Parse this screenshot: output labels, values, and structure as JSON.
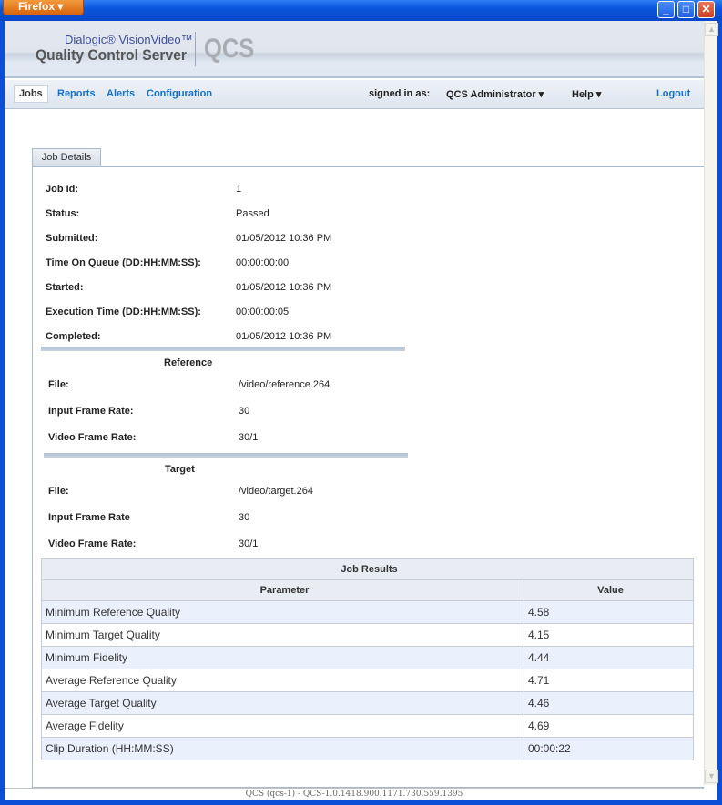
{
  "browser": {
    "menu_label": "Firefox"
  },
  "logo": {
    "line1": "Dialogic® VisionVideo™",
    "line2": "Quality Control Server",
    "mark": "QCS"
  },
  "nav": {
    "items": [
      "Jobs",
      "Reports",
      "Alerts",
      "Configuration"
    ],
    "signed_in_label": "signed in as:",
    "user": "QCS Administrator ▾",
    "help": "Help ▾",
    "logout": "Logout"
  },
  "tab": "Job Details",
  "details": [
    {
      "label": "Job Id:",
      "value": "1"
    },
    {
      "label": "Status:",
      "value": "Passed"
    },
    {
      "label": "Submitted:",
      "value": "01/05/2012 10:36 PM"
    },
    {
      "label": "Time On Queue (DD:HH:MM:SS):",
      "value": "00:00:00:00"
    },
    {
      "label": "Started:",
      "value": "01/05/2012 10:36 PM"
    },
    {
      "label": "Execution Time (DD:HH:MM:SS):",
      "value": "00:00:00:05"
    },
    {
      "label": "Completed:",
      "value": "01/05/2012 10:36 PM"
    }
  ],
  "reference": {
    "title": "Reference",
    "rows": [
      {
        "label": "File:",
        "value": "/video/reference.264"
      },
      {
        "label": "Input Frame Rate:",
        "value": "30"
      },
      {
        "label": "Video Frame Rate:",
        "value": "30/1"
      }
    ]
  },
  "target": {
    "title": "Target",
    "rows": [
      {
        "label": "File:",
        "value": "/video/target.264"
      },
      {
        "label": "Input Frame Rate",
        "value": "30"
      },
      {
        "label": "Video Frame Rate:",
        "value": "30/1"
      }
    ]
  },
  "results": {
    "title": "Job Results",
    "columns": [
      "Parameter",
      "Value"
    ],
    "rows": [
      [
        "Minimum Reference Quality",
        "4.58"
      ],
      [
        "Minimum Target Quality",
        "4.15"
      ],
      [
        "Minimum Fidelity",
        "4.44"
      ],
      [
        "Average Reference Quality",
        "4.71"
      ],
      [
        "Average Target Quality",
        "4.46"
      ],
      [
        "Average Fidelity",
        "4.69"
      ],
      [
        "Clip Duration (HH:MM:SS)",
        "00:00:22"
      ]
    ]
  },
  "footer": "QCS (qcs-1) - QCS-1.0.1418.900.1171.730.559.1395"
}
